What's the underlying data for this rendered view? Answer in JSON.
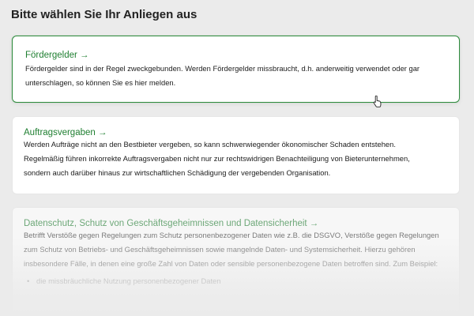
{
  "page": {
    "title": "Bitte wählen Sie Ihr Anliegen aus"
  },
  "cards": [
    {
      "title": "Fördergelder →",
      "body": "Fördergelder sind in der Regel zweckgebunden. Werden Fördergelder missbraucht, d.h. anderweitig verwendet oder gar unterschlagen, so können Sie es hier melden."
    },
    {
      "title": "Auftragsvergaben →",
      "body_lines": [
        "Werden Aufträge nicht an den Bestbieter vergeben, so kann schwerwiegender ökonomischer Schaden entstehen.",
        "Regelmäßig führen inkorrekte Auftragsvergaben nicht nur zur rechtswidrigen Benachteiligung von Bieterunternehmen,",
        "sondern auch darüber hinaus zur wirtschaftlichen Schädigung der vergebenden Organisation."
      ]
    },
    {
      "title": "Datenschutz, Schutz von Geschäftsgeheimnissen und Datensicherheit →",
      "body": "Betrifft Verstöße gegen Regelungen zum Schutz personenbezogener Daten wie z.B. die DSGVO, Verstöße gegen Regelungen zum Schutz von Betriebs- und Geschäftsgeheimnissen sowie mangelnde Daten- und Systemsicherheit. Hierzu gehören insbesondere Fälle, in denen eine große Zahl von Daten oder sensible personenbezogene Daten betroffen sind. Zum Beispiel:",
      "list": [
        "die missbräuchliche Nutzung personenbezogener Daten"
      ]
    }
  ],
  "colors": {
    "accent": "#2e8b3d",
    "title_green": "#1f7f31",
    "background": "#ebebeb"
  }
}
